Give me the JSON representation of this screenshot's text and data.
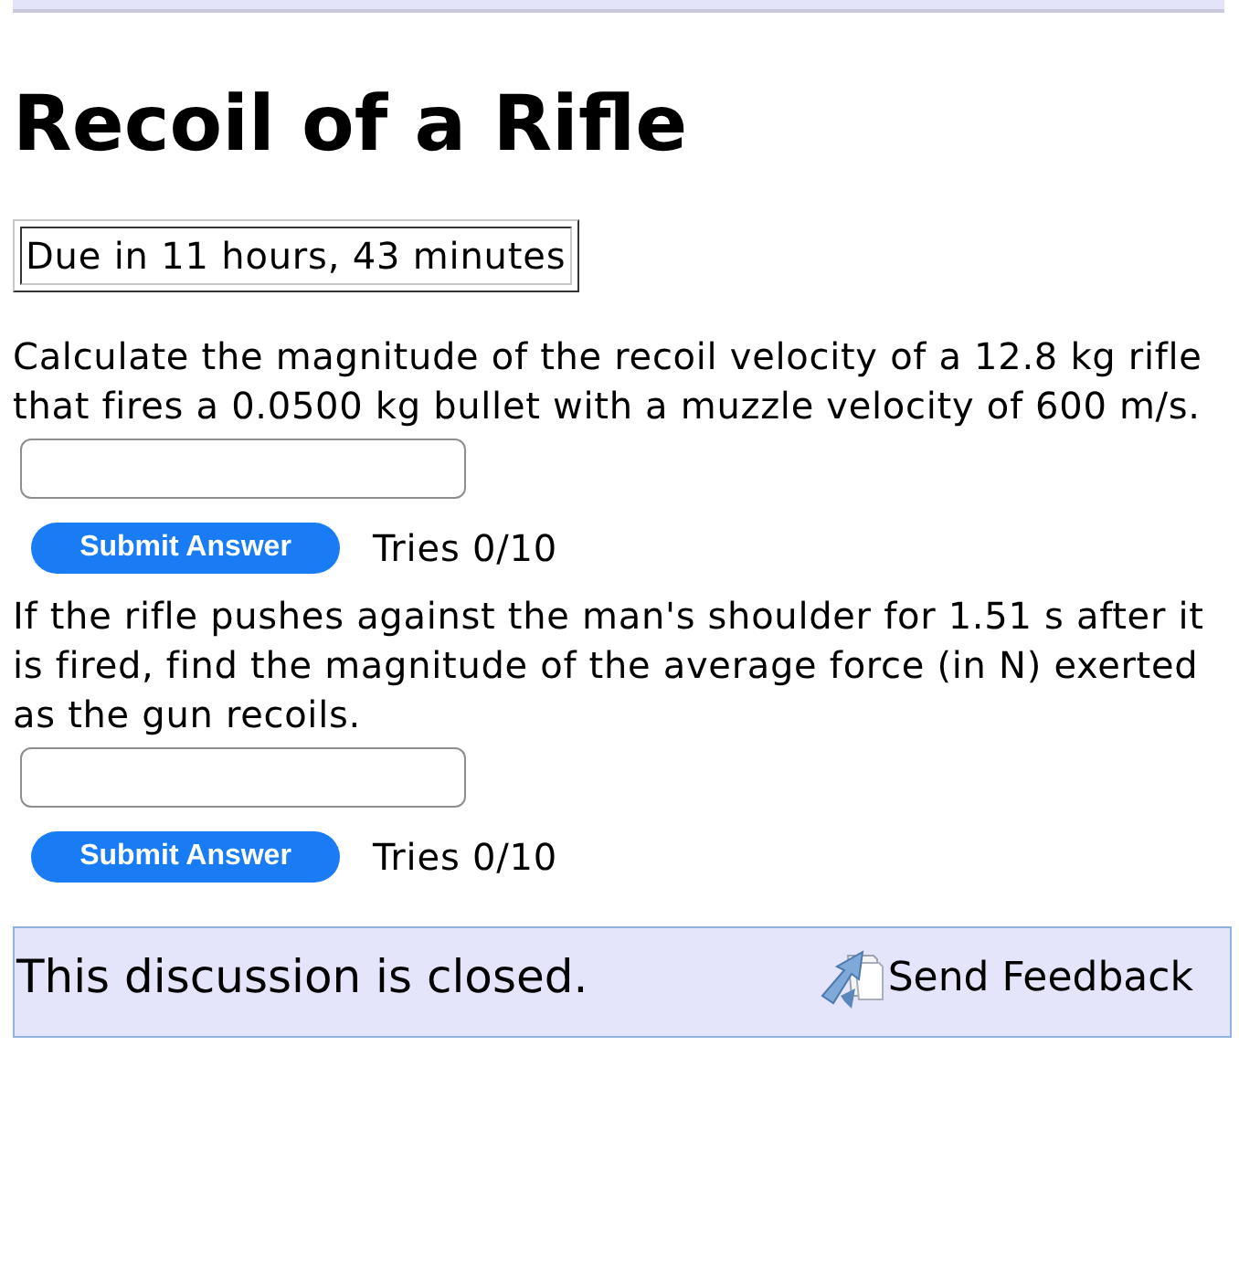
{
  "title": "Recoil of a Rifle",
  "due": "Due in 11 hours, 43 minutes",
  "questions": [
    {
      "prompt": "Calculate the magnitude of the recoil velocity of a 12.8 kg rifle that fires a 0.0500 kg bullet with a muzzle velocity of 600 m/s.",
      "button": "Submit Answer",
      "tries": "Tries 0/10"
    },
    {
      "prompt": "If the rifle pushes against the man's shoulder for 1.51 s after it is fired, find the magnitude of the average force (in N) exerted as the gun recoils.",
      "button": "Submit Answer",
      "tries": "Tries 0/10"
    }
  ],
  "discussion": {
    "status": "This discussion is closed.",
    "feedback_link": "Send Feedback"
  }
}
